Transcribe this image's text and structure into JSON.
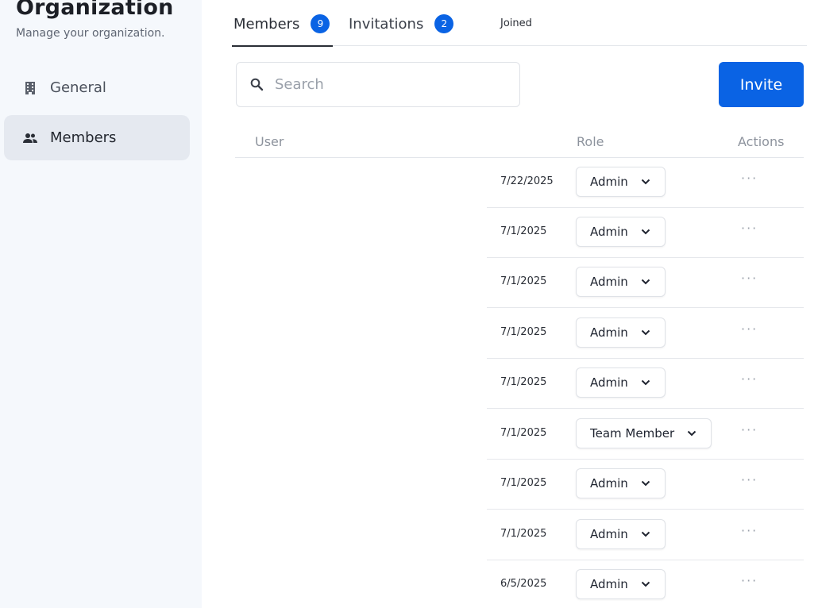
{
  "sidebar": {
    "title": "Organization",
    "subtitle": "Manage your organization.",
    "items": [
      {
        "label": "General",
        "icon": "building-icon"
      },
      {
        "label": "Members",
        "icon": "users-icon",
        "active": true
      }
    ]
  },
  "tabs": [
    {
      "label": "Members",
      "count": "9",
      "active": true
    },
    {
      "label": "Invitations",
      "count": "2"
    }
  ],
  "search": {
    "placeholder": "Search",
    "value": ""
  },
  "invite_label": "Invite",
  "table": {
    "headers": {
      "user": "User",
      "joined": "Joined",
      "role": "Role",
      "actions": "Actions"
    },
    "rows": [
      {
        "joined": "7/22/2025",
        "role": "Admin"
      },
      {
        "joined": "7/1/2025",
        "role": "Admin"
      },
      {
        "joined": "7/1/2025",
        "role": "Admin"
      },
      {
        "joined": "7/1/2025",
        "role": "Admin"
      },
      {
        "joined": "7/1/2025",
        "role": "Admin"
      },
      {
        "joined": "7/1/2025",
        "role": "Team Member"
      },
      {
        "joined": "7/1/2025",
        "role": "Admin"
      },
      {
        "joined": "7/1/2025",
        "role": "Admin"
      },
      {
        "joined": "6/5/2025",
        "role": "Admin"
      }
    ]
  },
  "colors": {
    "accent": "#0a63e4",
    "sidebar_bg": "#f5f8fc",
    "active_nav_bg": "#e5e9f0"
  }
}
